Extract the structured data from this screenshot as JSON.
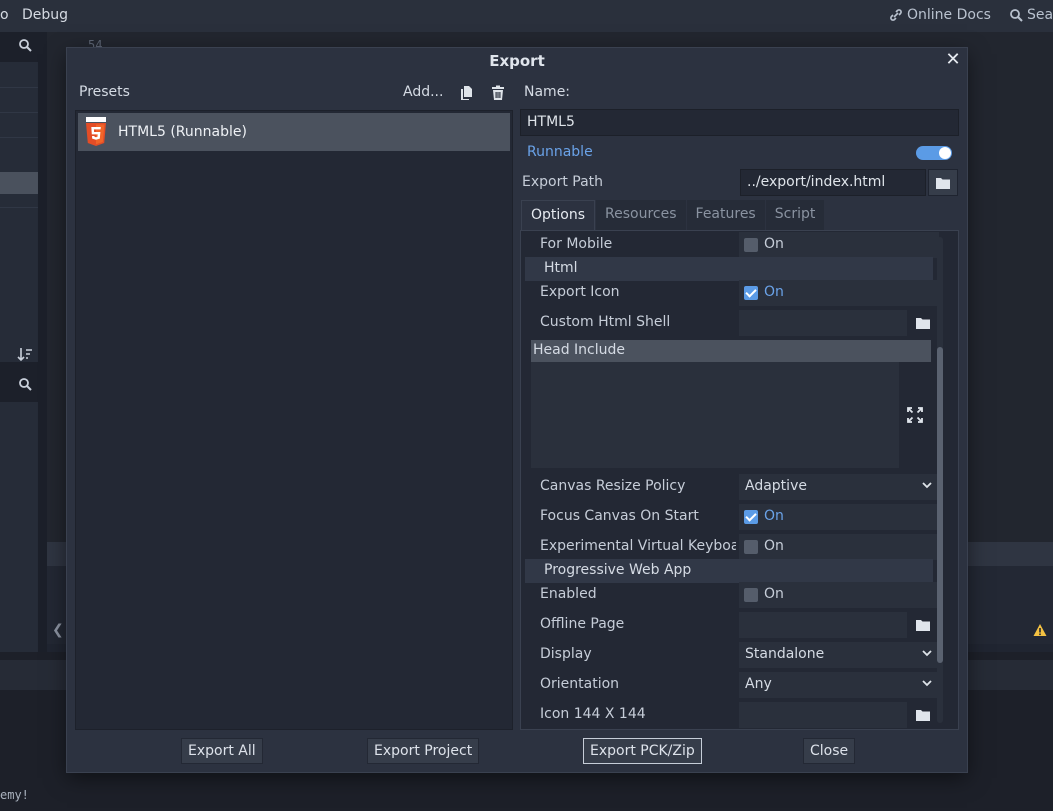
{
  "background": {
    "menu": {
      "item_o": "o",
      "item_debug": "Debug",
      "online_docs": "Online Docs",
      "search": "Sear"
    },
    "line_number": "54",
    "console_text": "emy!"
  },
  "dialog": {
    "title": "Export",
    "presets_label": "Presets",
    "add_label": "Add...",
    "preset_items": [
      {
        "label": "HTML5 (Runnable)"
      }
    ],
    "name_label": "Name:",
    "name_value": "HTML5",
    "runnable_label": "Runnable",
    "runnable_on": true,
    "export_path_label": "Export Path",
    "export_path_value": "../export/index.html",
    "tabs": [
      "Options",
      "Resources",
      "Features",
      "Script"
    ],
    "active_tab": "Options",
    "options": {
      "for_mobile": {
        "label": "For Mobile",
        "value": "On",
        "checked": false
      },
      "section_html": "Html",
      "export_icon": {
        "label": "Export Icon",
        "value": "On",
        "checked": true
      },
      "custom_html_shell": {
        "label": "Custom Html Shell",
        "value": ""
      },
      "head_include": {
        "label": "Head Include",
        "value": ""
      },
      "canvas_resize_policy": {
        "label": "Canvas Resize Policy",
        "value": "Adaptive"
      },
      "focus_canvas": {
        "label": "Focus Canvas On Start",
        "value": "On",
        "checked": true
      },
      "virtual_keyboard": {
        "label": "Experimental Virtual Keyboar",
        "value": "On",
        "checked": false
      },
      "section_pwa": "Progressive Web App",
      "enabled": {
        "label": "Enabled",
        "value": "On",
        "checked": false
      },
      "offline_page": {
        "label": "Offline Page",
        "value": ""
      },
      "display": {
        "label": "Display",
        "value": "Standalone"
      },
      "orientation": {
        "label": "Orientation",
        "value": "Any"
      },
      "icon_144": {
        "label": "Icon 144 X 144",
        "value": ""
      }
    },
    "buttons": {
      "export_all": "Export All",
      "export_project": "Export Project",
      "export_pck": "Export PCK/Zip",
      "close": "Close"
    }
  },
  "colors": {
    "accent": "#5b9be6",
    "accent_text": "#6aa2e8",
    "html5_orange": "#e44d26",
    "warning": "#f5c242"
  }
}
